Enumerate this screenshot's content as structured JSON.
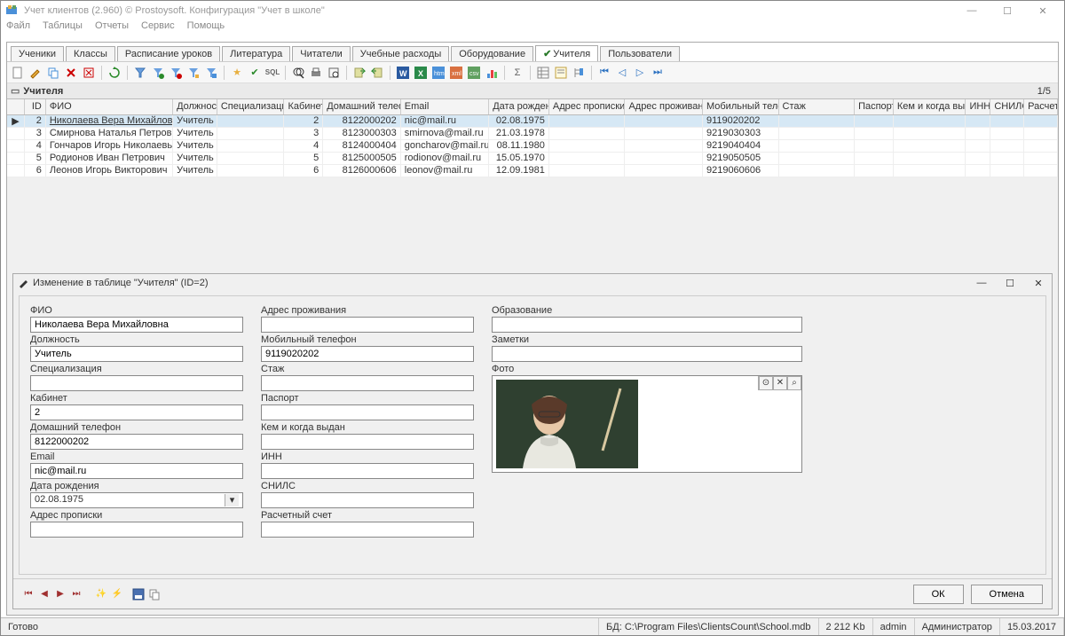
{
  "window": {
    "title": "Учет клиентов (2.960) © Prostoysoft. Конфигурация \"Учет в школе\""
  },
  "menu": [
    "Файл",
    "Таблицы",
    "Отчеты",
    "Сервис",
    "Помощь"
  ],
  "tabs": [
    {
      "label": "Ученики"
    },
    {
      "label": "Классы"
    },
    {
      "label": "Расписание уроков"
    },
    {
      "label": "Литература"
    },
    {
      "label": "Читатели"
    },
    {
      "label": "Учебные расходы"
    },
    {
      "label": "Оборудование"
    },
    {
      "label": "Учителя",
      "active": true
    },
    {
      "label": "Пользователи"
    }
  ],
  "grid": {
    "title": "Учителя",
    "counter": "1/5",
    "columns": [
      "ID",
      "ФИО",
      "Должность",
      "Специализация",
      "Кабинет",
      "Домашний телефон",
      "Email",
      "Дата рождения",
      "Адрес прописки",
      "Адрес проживания",
      "Мобильный телефон",
      "Стаж",
      "Паспорт",
      "Кем и когда выдан",
      "ИНН",
      "СНИЛС",
      "Расчетн"
    ],
    "rows": [
      {
        "id": "2",
        "fio": "Николаева Вера Михайловна",
        "dol": "Учитель",
        "spec": "",
        "kab": "2",
        "tel": "8122000202",
        "email": "nic@mail.ru",
        "dob": "02.08.1975",
        "adr1": "",
        "adr2": "",
        "mob": "9119020202",
        "sel": true
      },
      {
        "id": "3",
        "fio": "Смирнова Наталья Петровна",
        "dol": "Учитель",
        "spec": "",
        "kab": "3",
        "tel": "8123000303",
        "email": "smirnova@mail.ru",
        "dob": "21.03.1978",
        "adr1": "",
        "adr2": "",
        "mob": "9219030303"
      },
      {
        "id": "4",
        "fio": "Гончаров Игорь Николаевьич",
        "dol": "Учитель",
        "spec": "",
        "kab": "4",
        "tel": "8124000404",
        "email": "goncharov@mail.ru",
        "dob": "08.11.1980",
        "adr1": "",
        "adr2": "",
        "mob": "9219040404"
      },
      {
        "id": "5",
        "fio": "Родионов Иван Петрович",
        "dol": "Учитель",
        "spec": "",
        "kab": "5",
        "tel": "8125000505",
        "email": "rodionov@mail.ru",
        "dob": "15.05.1970",
        "adr1": "",
        "adr2": "",
        "mob": "9219050505"
      },
      {
        "id": "6",
        "fio": "Леонов Игорь Викторович",
        "dol": "Учитель",
        "spec": "",
        "kab": "6",
        "tel": "8126000606",
        "email": "leonov@mail.ru",
        "dob": "12.09.1981",
        "adr1": "",
        "adr2": "",
        "mob": "9219060606"
      }
    ]
  },
  "edit": {
    "title": "Изменение в таблице \"Учителя\" (ID=2)",
    "col1": {
      "fio": {
        "label": "ФИО",
        "value": "Николаева Вера Михайловна"
      },
      "dol": {
        "label": "Должность",
        "value": "Учитель"
      },
      "spec": {
        "label": "Специализация",
        "value": ""
      },
      "kab": {
        "label": "Кабинет",
        "value": "2"
      },
      "tel": {
        "label": "Домашний телефон",
        "value": "8122000202"
      },
      "email": {
        "label": "Email",
        "value": "nic@mail.ru"
      },
      "dob": {
        "label": "Дата рождения",
        "value": "02.08.1975"
      },
      "adr1": {
        "label": "Адрес прописки",
        "value": ""
      }
    },
    "col2": {
      "adr2": {
        "label": "Адрес проживания",
        "value": ""
      },
      "mob": {
        "label": "Мобильный телефон",
        "value": "9119020202"
      },
      "staj": {
        "label": "Стаж",
        "value": ""
      },
      "pass": {
        "label": "Паспорт",
        "value": ""
      },
      "kem": {
        "label": "Кем и когда выдан",
        "value": ""
      },
      "inn": {
        "label": "ИНН",
        "value": ""
      },
      "snils": {
        "label": "СНИЛС",
        "value": ""
      },
      "rasch": {
        "label": "Расчетный счет",
        "value": ""
      }
    },
    "col3": {
      "edu": {
        "label": "Образование",
        "value": ""
      },
      "notes": {
        "label": "Заметки",
        "value": ""
      },
      "photo": {
        "label": "Фото"
      }
    },
    "buttons": {
      "ok": "ОК",
      "cancel": "Отмена"
    }
  },
  "status": {
    "ready": "Готово",
    "db_label": "БД:",
    "db_path": "C:\\Program Files\\ClientsCount\\School.mdb",
    "size": "2 212 Kb",
    "user": "admin",
    "role": "Администратор",
    "date": "15.03.2017"
  }
}
